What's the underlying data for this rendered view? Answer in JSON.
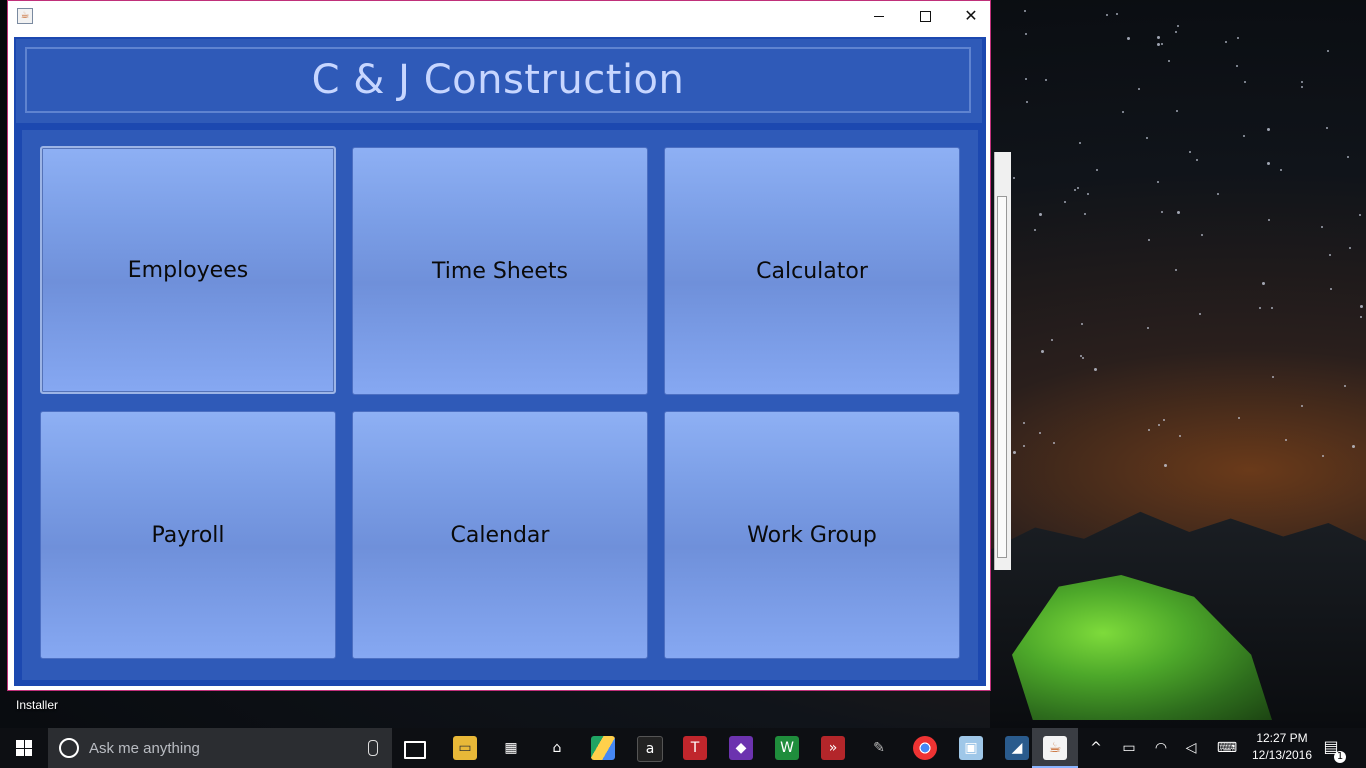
{
  "window": {
    "title_icon": "java-icon",
    "minimize_icon": "minimize-icon",
    "maximize_icon": "maximize-icon",
    "close_icon": "close-icon",
    "close_glyph": "✕"
  },
  "header": {
    "title": "C & J Construction"
  },
  "tiles": [
    {
      "label": "Employees"
    },
    {
      "label": "Time Sheets"
    },
    {
      "label": "Calculator"
    },
    {
      "label": "Payroll"
    },
    {
      "label": "Calendar"
    },
    {
      "label": "Work Group"
    }
  ],
  "desktop": {
    "labels": [
      "Installer"
    ]
  },
  "taskbar": {
    "search_placeholder": "Ask me anything",
    "pinned_icons": [
      "task-view-icon",
      "file-explorer-icon",
      "store-icon",
      "home-icon",
      "google-drive-icon",
      "amazon-icon",
      "t-app-icon",
      "visual-studio-icon",
      "webstorm-icon",
      "powershell-icon",
      "gimp-icon",
      "chrome-icon",
      "virtualbox-icon",
      "wireshark-icon",
      "java-icon"
    ],
    "time": "12:27 PM",
    "date": "12/13/2016",
    "notification_count": "1"
  },
  "colors": {
    "window_border": "#c0307a",
    "content_bg": "#1c48b0",
    "panel_bg": "#2f5ab8",
    "title_text": "#c7d6ff",
    "tile_top": "#8eb0f4",
    "tile_mid": "#6f90da",
    "taskbar_bg": "#0d0f13"
  }
}
